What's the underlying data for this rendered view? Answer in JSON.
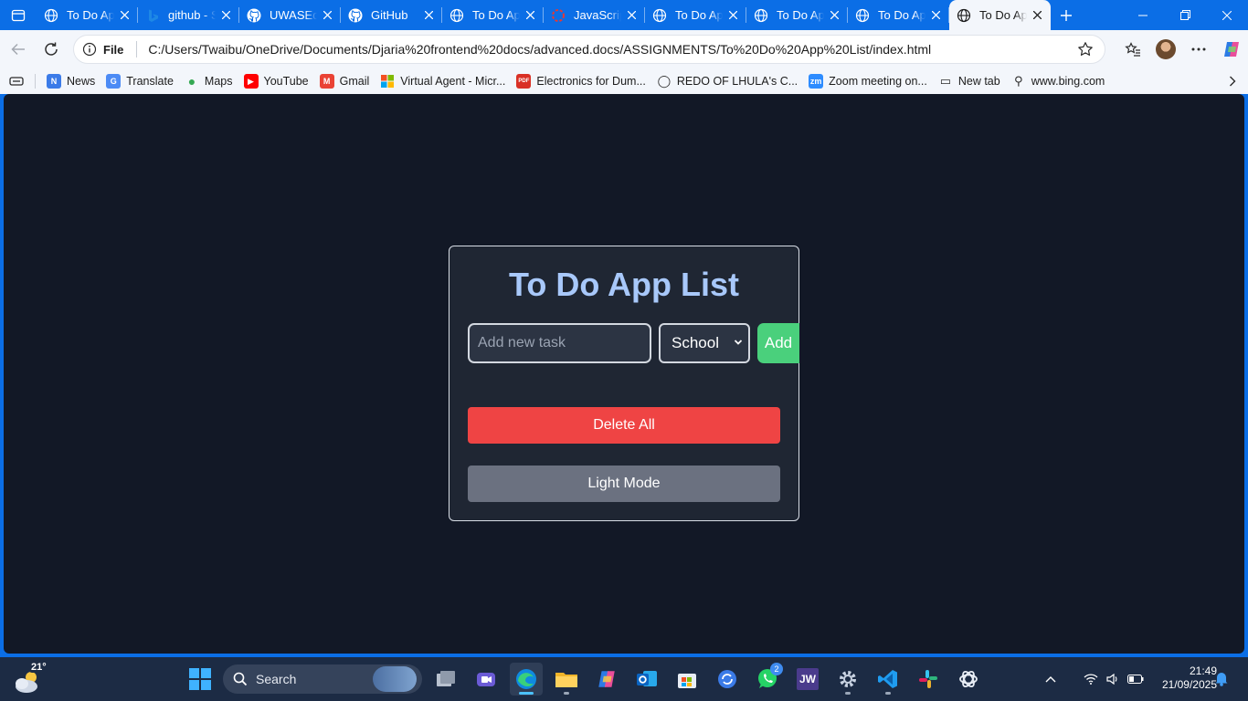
{
  "browser": {
    "tabs": [
      {
        "title": "To Do App List",
        "favicon": "globe-icon",
        "active": false
      },
      {
        "title": "github - Search",
        "favicon": "bing-icon",
        "active": false
      },
      {
        "title": "UWASEdjaria",
        "favicon": "github-icon",
        "active": false
      },
      {
        "title": "GitHub",
        "favicon": "github-icon",
        "active": false
      },
      {
        "title": "To Do App List",
        "favicon": "globe-icon",
        "active": false
      },
      {
        "title": "JavaScript",
        "favicon": "loading-icon",
        "active": false
      },
      {
        "title": "To Do App List",
        "favicon": "globe-icon",
        "active": false
      },
      {
        "title": "To Do App List",
        "favicon": "globe-icon",
        "active": false
      },
      {
        "title": "To Do App List",
        "favicon": "globe-icon",
        "active": false
      },
      {
        "title": "To Do App List",
        "favicon": "globe-icon",
        "active": true
      }
    ],
    "address": {
      "scheme_label": "File",
      "url": "C:/Users/Twaibu/OneDrive/Documents/Djaria%20frontend%20docs/advanced.docs/ASSIGNMENTS/To%20Do%20App%20List/index.html"
    },
    "favorites": [
      {
        "label": "News",
        "icon": "news-icon",
        "color": "#3b7be8"
      },
      {
        "label": "Translate",
        "icon": "translate-icon",
        "color": "#4c8bf5"
      },
      {
        "label": "Maps",
        "icon": "maps-pin-icon",
        "color": "#34a853"
      },
      {
        "label": "YouTube",
        "icon": "youtube-icon",
        "color": "#ff0000"
      },
      {
        "label": "Gmail",
        "icon": "gmail-icon",
        "color": "#ea4335"
      },
      {
        "label": "Virtual Agent - Micr...",
        "icon": "microsoft-icon",
        "color": "#f25022"
      },
      {
        "label": "Electronics for Dum...",
        "icon": "pdf-icon",
        "color": "#d93025"
      },
      {
        "label": "REDO OF LHULA's C...",
        "icon": "globe-icon",
        "color": "#555555"
      },
      {
        "label": "Zoom meeting on...",
        "icon": "zoom-icon",
        "color": "#2d8cff"
      },
      {
        "label": "New tab",
        "icon": "new-tab-icon",
        "color": "#555555"
      },
      {
        "label": "www.bing.com",
        "icon": "search-icon",
        "color": "#555555"
      }
    ]
  },
  "app": {
    "title": "To Do App List",
    "input_placeholder": "Add new task",
    "category_selected": "School",
    "add_label": "Add",
    "delete_all_label": "Delete All",
    "mode_toggle_label": "Light Mode",
    "colors": {
      "background": "#121826",
      "card": "#1f2633",
      "title": "#a8c8fa",
      "add": "#4ad07c",
      "delete": "#ef4444",
      "mode": "#6b7180"
    }
  },
  "taskbar": {
    "weather_temp": "21°",
    "search_label": "Search",
    "apps": [
      "task-view",
      "meet",
      "edge",
      "file-explorer",
      "copilot",
      "outlook",
      "store",
      "update",
      "whatsapp",
      "jw-library",
      "settings",
      "vs-code",
      "slack",
      "chatgpt"
    ],
    "whatsapp_badge": "2",
    "app_labels": {
      "jw": "JW"
    },
    "time": "21:49",
    "date": "21/09/2025"
  }
}
